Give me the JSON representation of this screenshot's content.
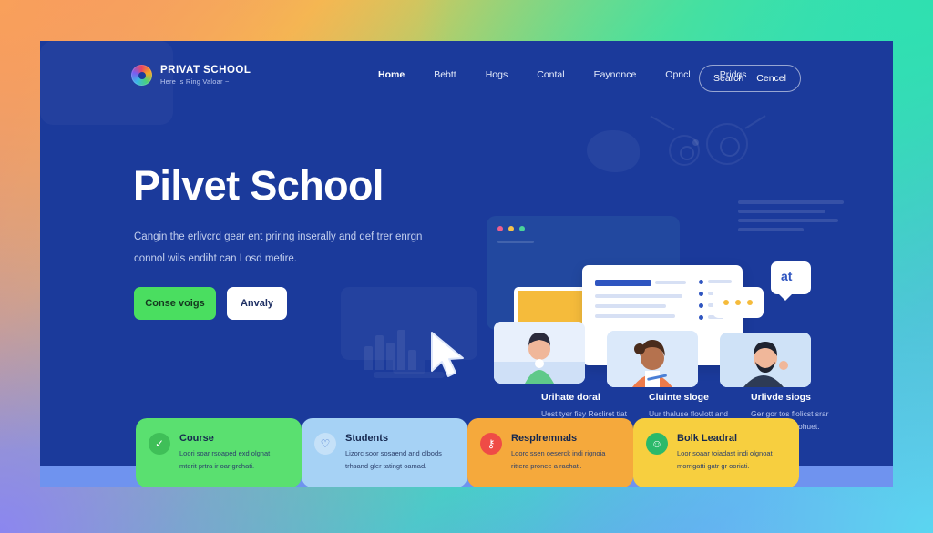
{
  "brand": {
    "name": "PRIVAT SCHOOL",
    "tagline": "Here Is Ring Valoar ~",
    "logo_icon": "color-wheel-icon"
  },
  "nav": {
    "items": [
      {
        "label": "Home"
      },
      {
        "label": "Bebtt"
      },
      {
        "label": "Hogs"
      },
      {
        "label": "Contal"
      },
      {
        "label": "Eaynonce"
      },
      {
        "label": "Opncl"
      },
      {
        "label": "Pridgs"
      }
    ],
    "search_label": "Search",
    "cancel_label": "Cencel"
  },
  "hero": {
    "title": "Pilvet School",
    "paragraph": "Cangin the erlivcrd gear ent priring inserally and def trer enrgn connol wils endiht can Losd metire.",
    "primary_button": "Conse voigs",
    "secondary_button": "Anvaly"
  },
  "illustration_cards": [
    {
      "title": "Urihate doral",
      "desc": "Uest tyer fisy Recliret tiat sudert oealor ridkia."
    },
    {
      "title": "Cluinte sloge",
      "desc": "Uur thaluse flovlott and spport cwl car inted."
    },
    {
      "title": "Urlivde siogs",
      "desc": "Ger gor tos flolicst srar sucert and or ohuet."
    }
  ],
  "chat": {
    "bubble_badge": "at",
    "typing_dots": "three-dots"
  },
  "features": [
    {
      "title": "Course",
      "desc": "Loori soar rsoaped exd olgnat mterit prtra ir oar grchati.",
      "icon": "check-circle-icon",
      "color": "#5ae070"
    },
    {
      "title": "Students",
      "desc": "Lizorc soor sosaend and olbods trhsand gler tatingt oamad.",
      "icon": "heart-icon",
      "color": "#a6d2f5"
    },
    {
      "title": "Resplremnals",
      "desc": "Loorc ssen oeserck indi rignoia rittera pronee a rachati.",
      "icon": "key-icon",
      "color": "#f5a93c"
    },
    {
      "title": "Bolk Leadral",
      "desc": "Loor soaar toiadast indi olgnoat morrigatti gatr gr ooriati.",
      "icon": "smiley-icon",
      "color": "#f7cf3f"
    }
  ],
  "theme": {
    "card_bg": "#1b3a9b",
    "accent_green": "#4ade60",
    "accent_yellow": "#f5bb3b",
    "band": "#6f93ef"
  }
}
